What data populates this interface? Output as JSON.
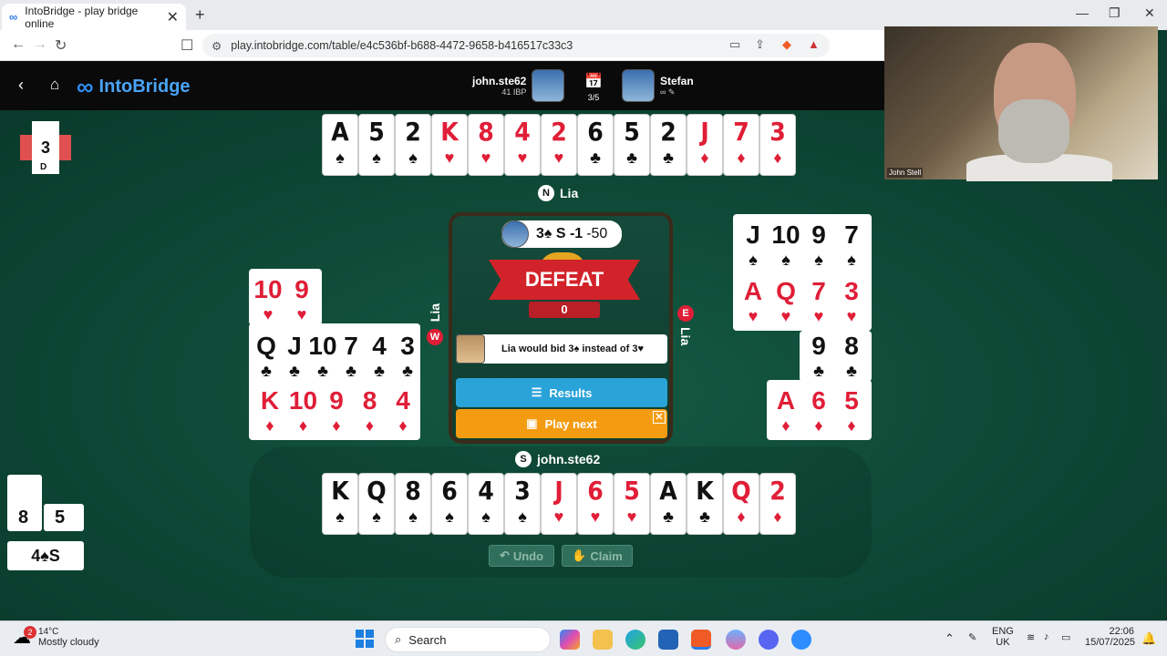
{
  "browser": {
    "tab_title": "IntoBridge - play bridge online",
    "tab_close": "✕",
    "new_tab": "+",
    "url": "play.intobridge.com/table/e4c536bf-b688-4472-9658-b416517c33c3",
    "window_controls": {
      "minimize": "—",
      "restore": "❐",
      "close": "✕"
    }
  },
  "header": {
    "brand": "IntoBridge",
    "players": [
      {
        "name": "john.ste62",
        "sub": "41 IBP"
      },
      {
        "name": "Stefan",
        "sub": ""
      }
    ],
    "board_count": "3/5"
  },
  "video": {
    "caption": "John Stell"
  },
  "dealer_panel": {
    "board_number": "3",
    "dealer": "D"
  },
  "north": {
    "seat_label": "N",
    "name": "Lia",
    "cards": [
      {
        "rank": "A",
        "suit": "♠",
        "color": "blk"
      },
      {
        "rank": "5",
        "suit": "♠",
        "color": "blk"
      },
      {
        "rank": "2",
        "suit": "♠",
        "color": "blk"
      },
      {
        "rank": "K",
        "suit": "♥",
        "color": "red"
      },
      {
        "rank": "8",
        "suit": "♥",
        "color": "red"
      },
      {
        "rank": "4",
        "suit": "♥",
        "color": "red"
      },
      {
        "rank": "2",
        "suit": "♥",
        "color": "red"
      },
      {
        "rank": "6",
        "suit": "♣",
        "color": "blk"
      },
      {
        "rank": "5",
        "suit": "♣",
        "color": "blk"
      },
      {
        "rank": "2",
        "suit": "♣",
        "color": "blk"
      },
      {
        "rank": "J",
        "suit": "♦",
        "color": "red"
      },
      {
        "rank": "7",
        "suit": "♦",
        "color": "red"
      },
      {
        "rank": "3",
        "suit": "♦",
        "color": "red"
      }
    ]
  },
  "west": {
    "seat_label": "W",
    "name": "Lia",
    "rows": [
      [
        {
          "rank": "10",
          "suit": "♥",
          "color": "red"
        },
        {
          "rank": "9",
          "suit": "♥",
          "color": "red"
        }
      ],
      [
        {
          "rank": "Q",
          "suit": "♣",
          "color": "blk"
        },
        {
          "rank": "J",
          "suit": "♣",
          "color": "blk"
        },
        {
          "rank": "10",
          "suit": "♣",
          "color": "blk"
        },
        {
          "rank": "7",
          "suit": "♣",
          "color": "blk"
        },
        {
          "rank": "4",
          "suit": "♣",
          "color": "blk"
        },
        {
          "rank": "3",
          "suit": "♣",
          "color": "blk"
        }
      ],
      [
        {
          "rank": "K",
          "suit": "♦",
          "color": "red"
        },
        {
          "rank": "10",
          "suit": "♦",
          "color": "red"
        },
        {
          "rank": "9",
          "suit": "♦",
          "color": "red"
        },
        {
          "rank": "8",
          "suit": "♦",
          "color": "red"
        },
        {
          "rank": "4",
          "suit": "♦",
          "color": "red"
        }
      ]
    ]
  },
  "east": {
    "seat_label": "E",
    "name": "Lia",
    "rows": [
      [
        {
          "rank": "J",
          "suit": "♠",
          "color": "blk"
        },
        {
          "rank": "10",
          "suit": "♠",
          "color": "blk"
        },
        {
          "rank": "9",
          "suit": "♠",
          "color": "blk"
        },
        {
          "rank": "7",
          "suit": "♠",
          "color": "blk"
        }
      ],
      [
        {
          "rank": "A",
          "suit": "♥",
          "color": "red"
        },
        {
          "rank": "Q",
          "suit": "♥",
          "color": "red"
        },
        {
          "rank": "7",
          "suit": "♥",
          "color": "red"
        },
        {
          "rank": "3",
          "suit": "♥",
          "color": "red"
        }
      ],
      [
        {
          "rank": "9",
          "suit": "♣",
          "color": "blk"
        },
        {
          "rank": "8",
          "suit": "♣",
          "color": "blk"
        }
      ],
      [
        {
          "rank": "A",
          "suit": "♦",
          "color": "red"
        },
        {
          "rank": "6",
          "suit": "♦",
          "color": "red"
        },
        {
          "rank": "5",
          "suit": "♦",
          "color": "red"
        }
      ]
    ]
  },
  "south": {
    "seat_label": "S",
    "name": "john.ste62",
    "cards": [
      {
        "rank": "K",
        "suit": "♠",
        "color": "blk"
      },
      {
        "rank": "Q",
        "suit": "♠",
        "color": "blk"
      },
      {
        "rank": "8",
        "suit": "♠",
        "color": "blk"
      },
      {
        "rank": "6",
        "suit": "♠",
        "color": "blk"
      },
      {
        "rank": "4",
        "suit": "♠",
        "color": "blk"
      },
      {
        "rank": "3",
        "suit": "♠",
        "color": "blk"
      },
      {
        "rank": "J",
        "suit": "♥",
        "color": "red"
      },
      {
        "rank": "6",
        "suit": "♥",
        "color": "red"
      },
      {
        "rank": "5",
        "suit": "♥",
        "color": "red"
      },
      {
        "rank": "A",
        "suit": "♣",
        "color": "blk"
      },
      {
        "rank": "K",
        "suit": "♣",
        "color": "blk"
      },
      {
        "rank": "Q",
        "suit": "♦",
        "color": "red"
      },
      {
        "rank": "2",
        "suit": "♦",
        "color": "red"
      }
    ]
  },
  "result": {
    "contract_line": "3♠ S -1",
    "points": "-50",
    "banner": "DEFEAT",
    "score": "0",
    "hint": "Lia would bid 3♠ instead of 3♥",
    "results_label": "Results",
    "play_next_label": "Play next"
  },
  "actions": {
    "undo": "Undo",
    "claim": "Claim"
  },
  "tricks": {
    "ours": "8",
    "theirs": "5",
    "contract": "4♠S"
  },
  "taskbar": {
    "temp": "14°C",
    "weather": "Mostly cloudy",
    "badge": "2",
    "search": "Search",
    "lang1": "ENG",
    "lang2": "UK",
    "time": "22:06",
    "date": "15/07/2025"
  }
}
